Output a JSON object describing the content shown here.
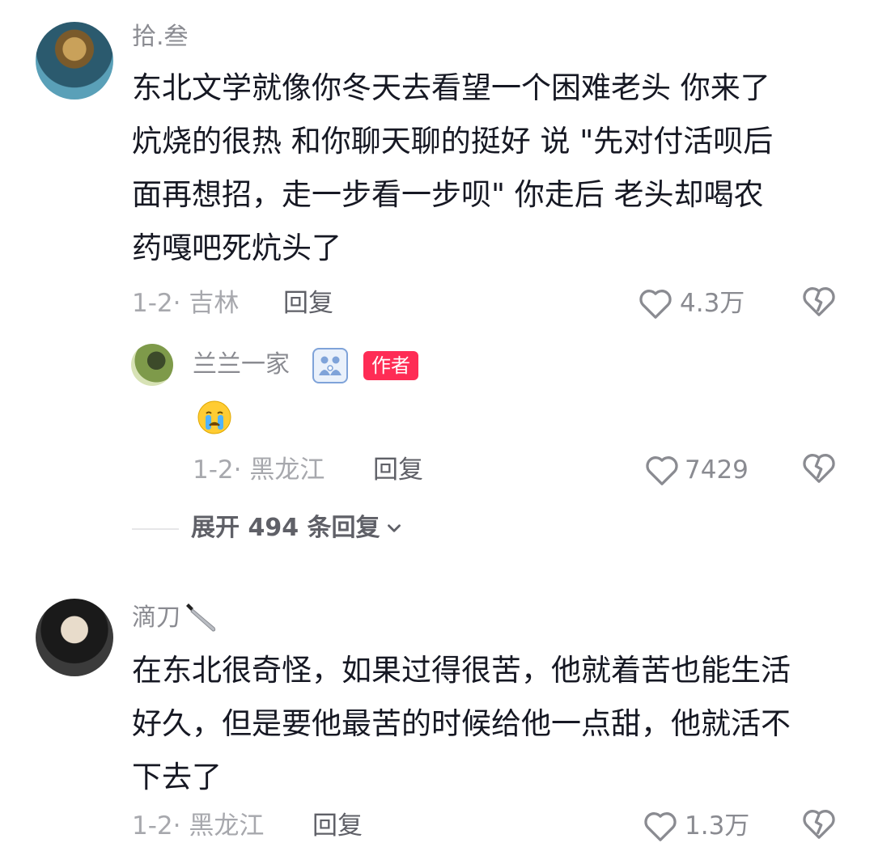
{
  "comments": [
    {
      "username": "拾.叁",
      "text": "东北文学就像你冬天去看望一个困难老头 你来了炕烧的很热 和你聊天聊的挺好 说 \"先对付活呗后面再想招，走一步看一步呗\" 你走后 老头却喝农药嘎吧死炕头了",
      "lines": [
        "东北文学就像你冬天去看望一个困难老头 你来了",
        "炕烧的很热 和你聊天聊的挺好 说 \"先对付活呗后",
        "面再想招，走一步看一步呗\" 你走后 老头却喝农",
        "药嘎吧死炕头了"
      ],
      "date_location": "1-2· 吉林",
      "reply_label": "回复",
      "likes": "4.3万",
      "reply": {
        "username": "兰兰一家",
        "author_badge": "作者",
        "emoji": "😭",
        "date_location": "1-2· 黑龙江",
        "reply_label": "回复",
        "likes": "7429"
      },
      "expand_label": "展开 494 条回复"
    },
    {
      "username": "滴刀",
      "username_emoji": "🔪",
      "text": "在东北很奇怪，如果过得很苦，他就着苦也能生活好久，但是要他最苦的时候给他一点甜，他就活不下去了",
      "lines": [
        "在东北很奇怪，如果过得很苦，他就着苦也能生活",
        "好久，但是要他最苦的时候给他一点甜，他就活不",
        "下去了"
      ],
      "date_location": "1-2· 黑龙江",
      "reply_label": "回复",
      "likes": "1.3万"
    }
  ],
  "icons": {
    "like": "heart-outline-icon",
    "dislike": "broken-heart-icon",
    "expand": "chevron-down-icon",
    "family_badge": "family-badge-icon"
  },
  "colors": {
    "author_badge": "#fe2c55",
    "username": "#8a8b91",
    "body_text": "#161823",
    "meta": "#a7a8ad"
  }
}
